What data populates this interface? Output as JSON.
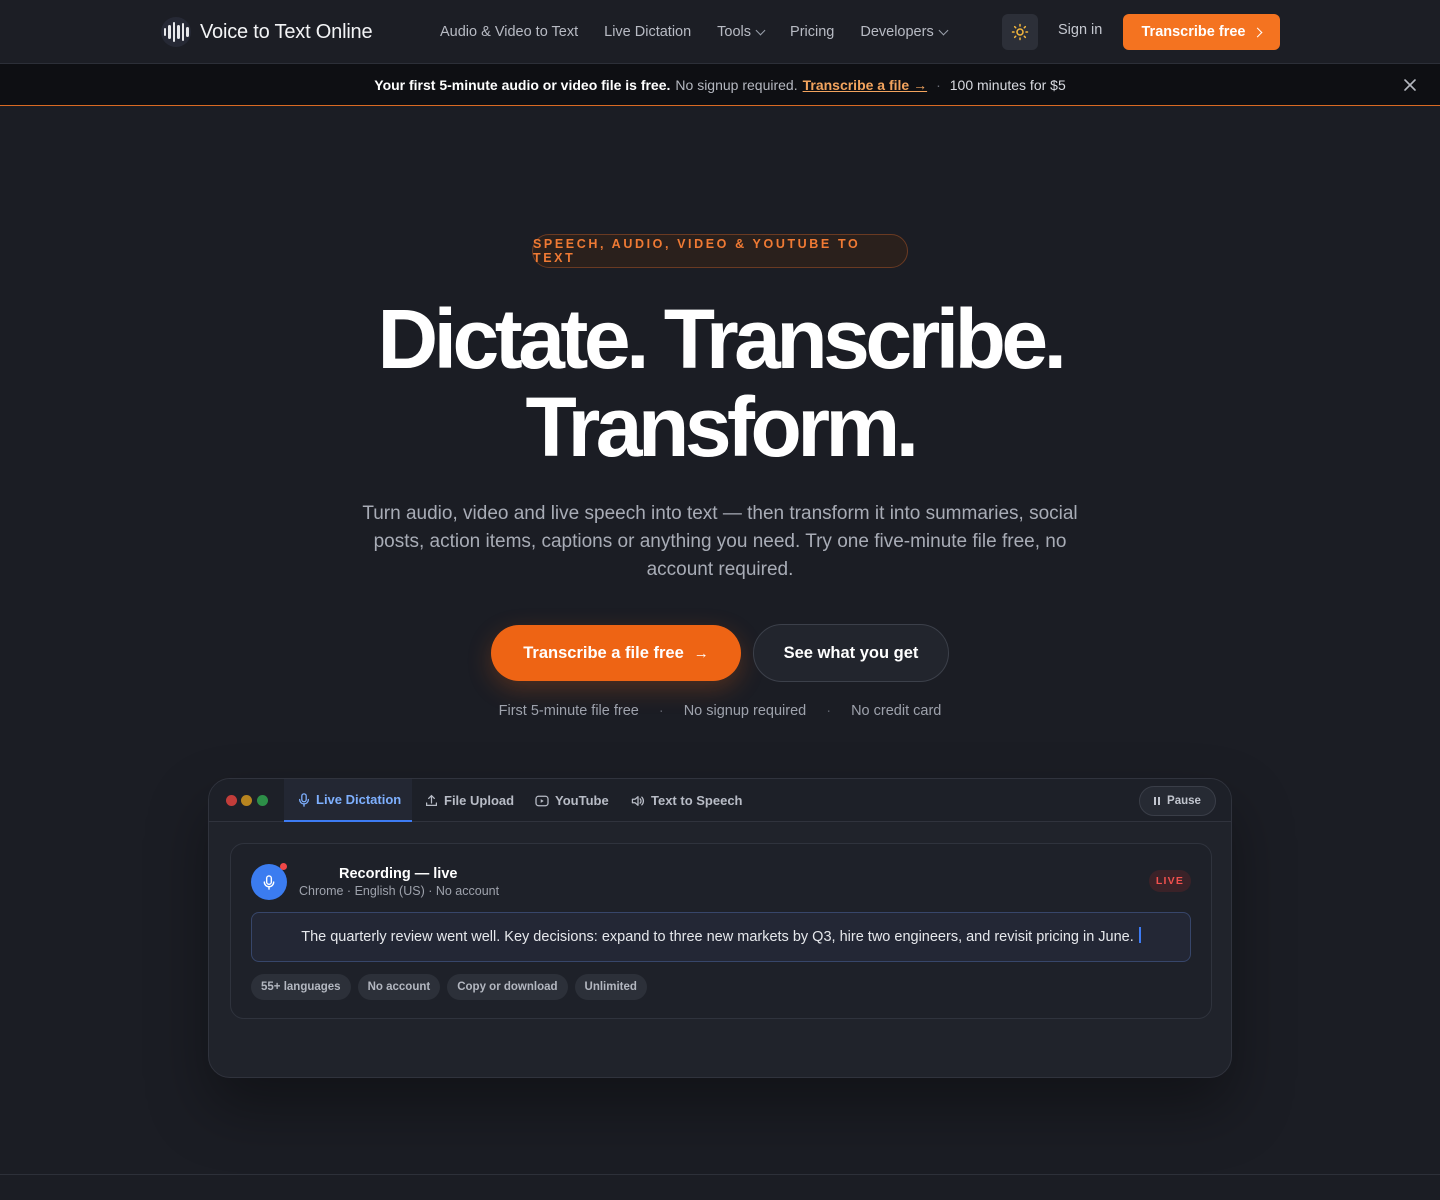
{
  "nav": {
    "brand": "Voice to Text Online",
    "links": [
      {
        "label": "Audio & Video to Text",
        "dropdown": false
      },
      {
        "label": "Live Dictation",
        "dropdown": false
      },
      {
        "label": "Tools",
        "dropdown": true
      },
      {
        "label": "Pricing",
        "dropdown": false
      },
      {
        "label": "Developers",
        "dropdown": true
      }
    ],
    "theme_icon": "sun-icon",
    "sign_in": "Sign in",
    "cta": "Transcribe free"
  },
  "banner": {
    "strong": "Your first 5-minute audio or video file is free.",
    "normal": "No signup required.",
    "link": "Transcribe a file →",
    "dot": "·",
    "price": "100 minutes for $5"
  },
  "hero": {
    "eyebrow": "SPEECH, AUDIO, VIDEO & YOUTUBE TO TEXT",
    "headline_line1": "Dictate. Transcribe.",
    "headline_line2": "Transform.",
    "subhead": "Turn audio, video and live speech into text — then transform it into summaries, social posts, action items, captions or anything you need. Try one five-minute file free, no account required.",
    "primary_cta": "Transcribe a file free",
    "primary_arrow": "→",
    "secondary_cta": "See what you get",
    "perks": [
      "First 5-minute file free",
      "No signup required",
      "No credit card"
    ],
    "perk_sep": "·"
  },
  "demo": {
    "tabs": [
      {
        "label": "Live Dictation",
        "icon": "mic-icon",
        "active": true
      },
      {
        "label": "File Upload",
        "icon": "upload-icon",
        "active": false
      },
      {
        "label": "YouTube",
        "icon": "youtube-icon",
        "active": false
      },
      {
        "label": "Text to Speech",
        "icon": "speaker-icon",
        "active": false
      }
    ],
    "pause": "Pause",
    "recording": {
      "title": "Recording — live",
      "meta": "Chrome · English (US) · No account",
      "badge": "LIVE",
      "transcript": "The quarterly review went well. Key decisions: expand to three new markets by Q3, hire two engineers, and revisit pricing in June."
    },
    "chips": [
      "55+ languages",
      "No account",
      "Copy or download",
      "Unlimited"
    ]
  },
  "colors": {
    "accent": "#f47320",
    "primary_cta": "#ee6414",
    "blue": "#3b7cf0",
    "live_red": "#f0504d",
    "background": "#1b1d24"
  }
}
